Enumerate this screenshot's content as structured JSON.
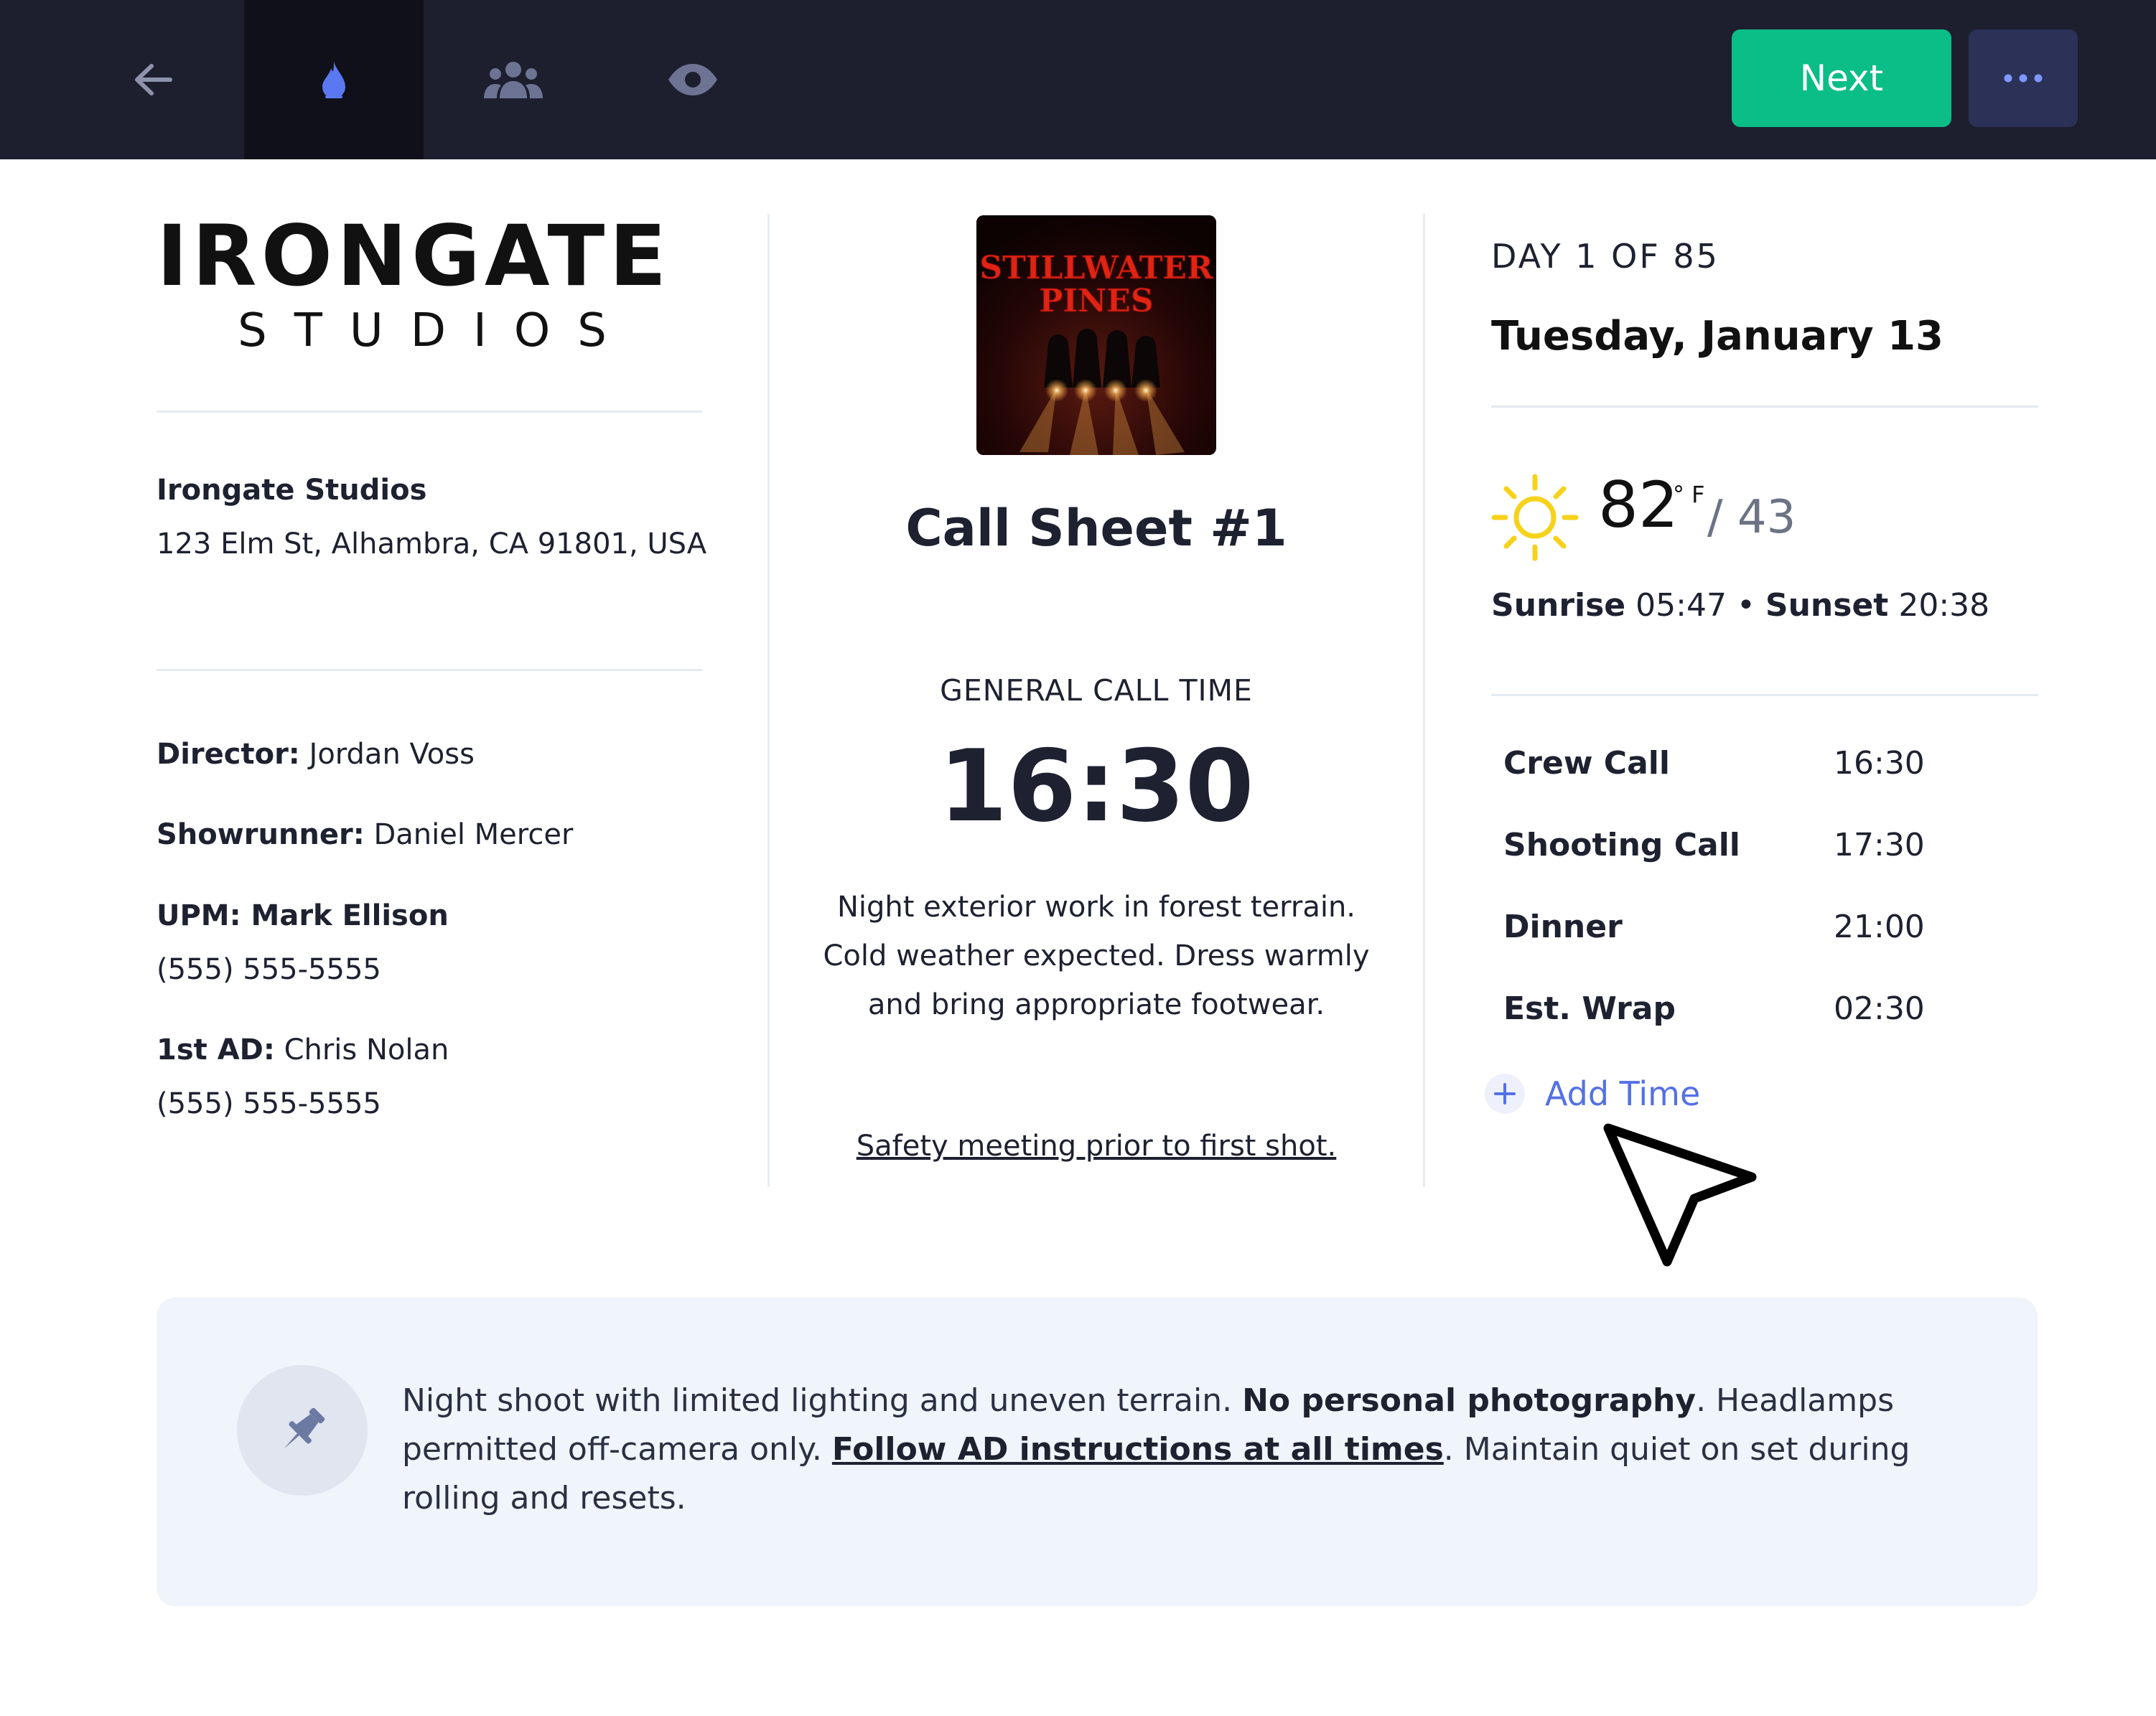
{
  "toolbar": {
    "next_label": "Next",
    "icons": [
      "back-arrow-icon",
      "fire-drop-icon",
      "crew-icon",
      "eye-icon",
      "more-dots-icon"
    ]
  },
  "colors": {
    "topbar": "#1d1f2e",
    "active_tab": "#0f1019",
    "next_button": "#0bbd87",
    "more_button": "#2b3157",
    "accent_blue": "#5470e6",
    "sun_yellow": "#f7d21b",
    "notes_bg": "#f0f4fb"
  },
  "logo": {
    "main": "IRONGATE",
    "sub": "STUDIOS"
  },
  "company": {
    "name": "Irongate Studios",
    "address": "123 Elm St, Alhambra, CA 91801, USA"
  },
  "contacts": {
    "director_label": "Director:",
    "director_name": "Jordan Voss",
    "showrunner_label": "Showrunner:",
    "showrunner_name": "Daniel Mercer",
    "upm_label": "UPM: Mark Ellison",
    "upm_phone": "(555) 555-5555",
    "ad_label": "1st AD:",
    "ad_name": "Chris Nolan",
    "ad_phone": "(555) 555-5555"
  },
  "poster": {
    "line1": "STILLWATER",
    "line2": "PINES"
  },
  "call_sheet": {
    "title": "Call Sheet #1",
    "general_call_label": "GENERAL CALL TIME",
    "general_call_time": "16:30",
    "note": "Night exterior work in forest terrain. Cold weather expected. Dress warmly and bring appropriate footwear.",
    "safety": "Safety meeting prior to first shot."
  },
  "day": {
    "label": "DAY 1 OF 85",
    "date": "Tuesday, January 13"
  },
  "weather": {
    "icon": "sun-icon",
    "high": "82",
    "unit": "° F",
    "low": "/ 43",
    "sunrise_label": "Sunrise",
    "sunrise": "05:47",
    "separator": "•",
    "sunset_label": "Sunset",
    "sunset": "20:38"
  },
  "schedule": [
    {
      "label": "Crew Call",
      "time": "16:30"
    },
    {
      "label": "Shooting Call",
      "time": "17:30"
    },
    {
      "label": "Dinner",
      "time": "21:00"
    },
    {
      "label": "Est. Wrap",
      "time": "02:30"
    }
  ],
  "add_time_label": "Add Time",
  "notes": {
    "icon": "pin-icon",
    "part1": "Night shoot with limited lighting and uneven terrain. ",
    "bold1": "No personal photography",
    "part2": ". Headlamps permitted off-camera only. ",
    "link": "Follow AD instructions at all times",
    "part3": ". Maintain quiet on set during rolling and resets."
  }
}
